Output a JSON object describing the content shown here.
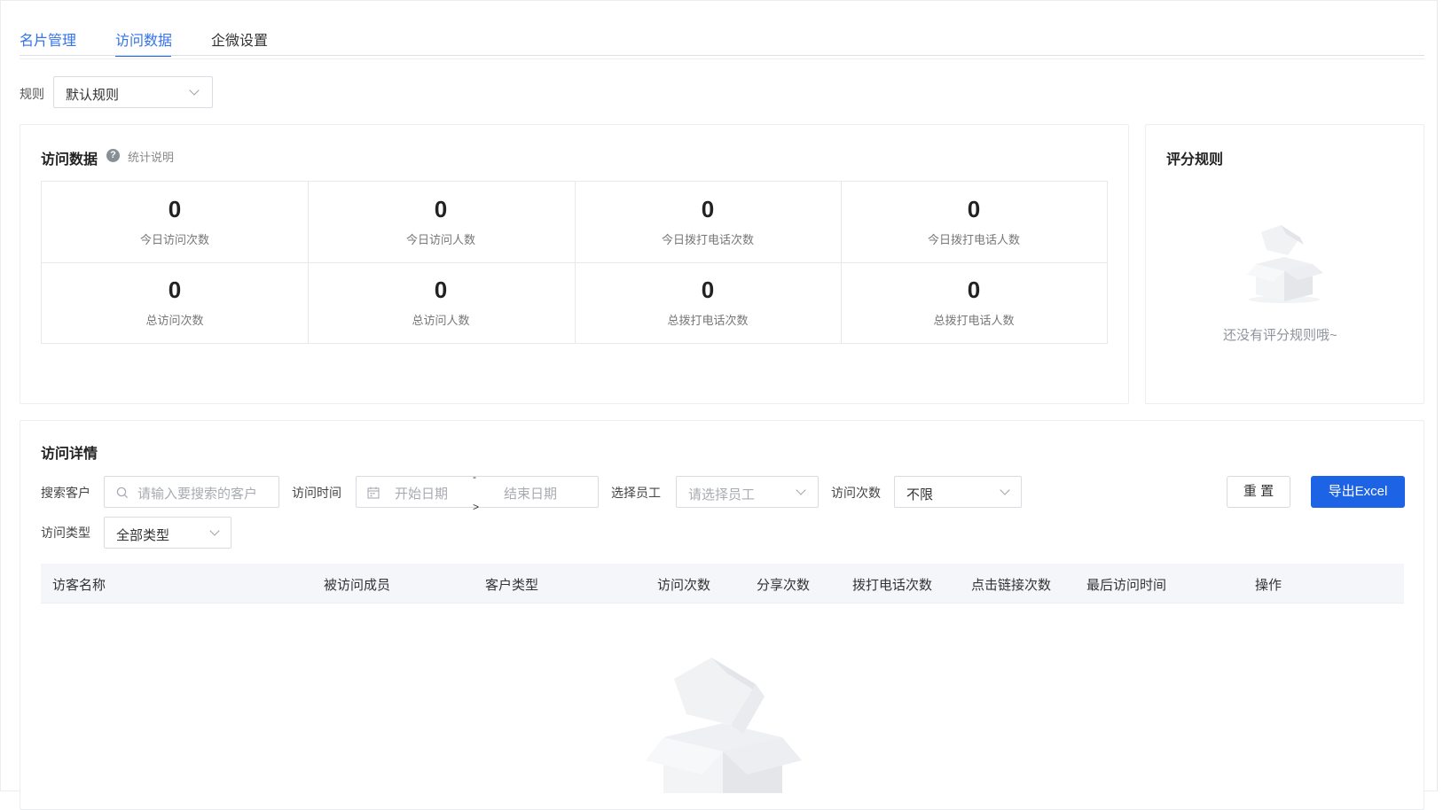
{
  "tabs": [
    {
      "label": "名片管理"
    },
    {
      "label": "访问数据"
    },
    {
      "label": "企微设置"
    }
  ],
  "rule": {
    "label": "规则",
    "value": "默认规则"
  },
  "visit_data": {
    "title": "访问数据",
    "help_text": "统计说明",
    "stats": [
      {
        "value": "0",
        "label": "今日访问次数"
      },
      {
        "value": "0",
        "label": "今日访问人数"
      },
      {
        "value": "0",
        "label": "今日拨打电话次数"
      },
      {
        "value": "0",
        "label": "今日拨打电话人数"
      },
      {
        "value": "0",
        "label": "总访问次数"
      },
      {
        "value": "0",
        "label": "总访问人数"
      },
      {
        "value": "0",
        "label": "总拨打电话次数"
      },
      {
        "value": "0",
        "label": "总拨打电话人数"
      }
    ]
  },
  "score_rules": {
    "title": "评分规则",
    "empty_text": "还没有评分规则哦~"
  },
  "detail": {
    "title": "访问详情",
    "filters": {
      "search_label": "搜索客户",
      "search_placeholder": "请输入要搜索的客户",
      "time_label": "访问时间",
      "start_placeholder": "开始日期",
      "separator_top": "-",
      "separator_bottom": ">",
      "end_placeholder": "结束日期",
      "employee_label": "选择员工",
      "employee_placeholder": "请选择员工",
      "count_label": "访问次数",
      "count_value": "不限",
      "type_label": "访问类型",
      "type_value": "全部类型"
    },
    "buttons": {
      "reset": "重 置",
      "export": "导出Excel"
    },
    "columns": [
      "访客名称",
      "被访问成员",
      "客户类型",
      "访问次数",
      "分享次数",
      "拨打电话次数",
      "点击链接次数",
      "最后访问时间",
      "操作"
    ]
  },
  "colors": {
    "accent": "#1d63e6",
    "tab_active": "#3372e8"
  }
}
